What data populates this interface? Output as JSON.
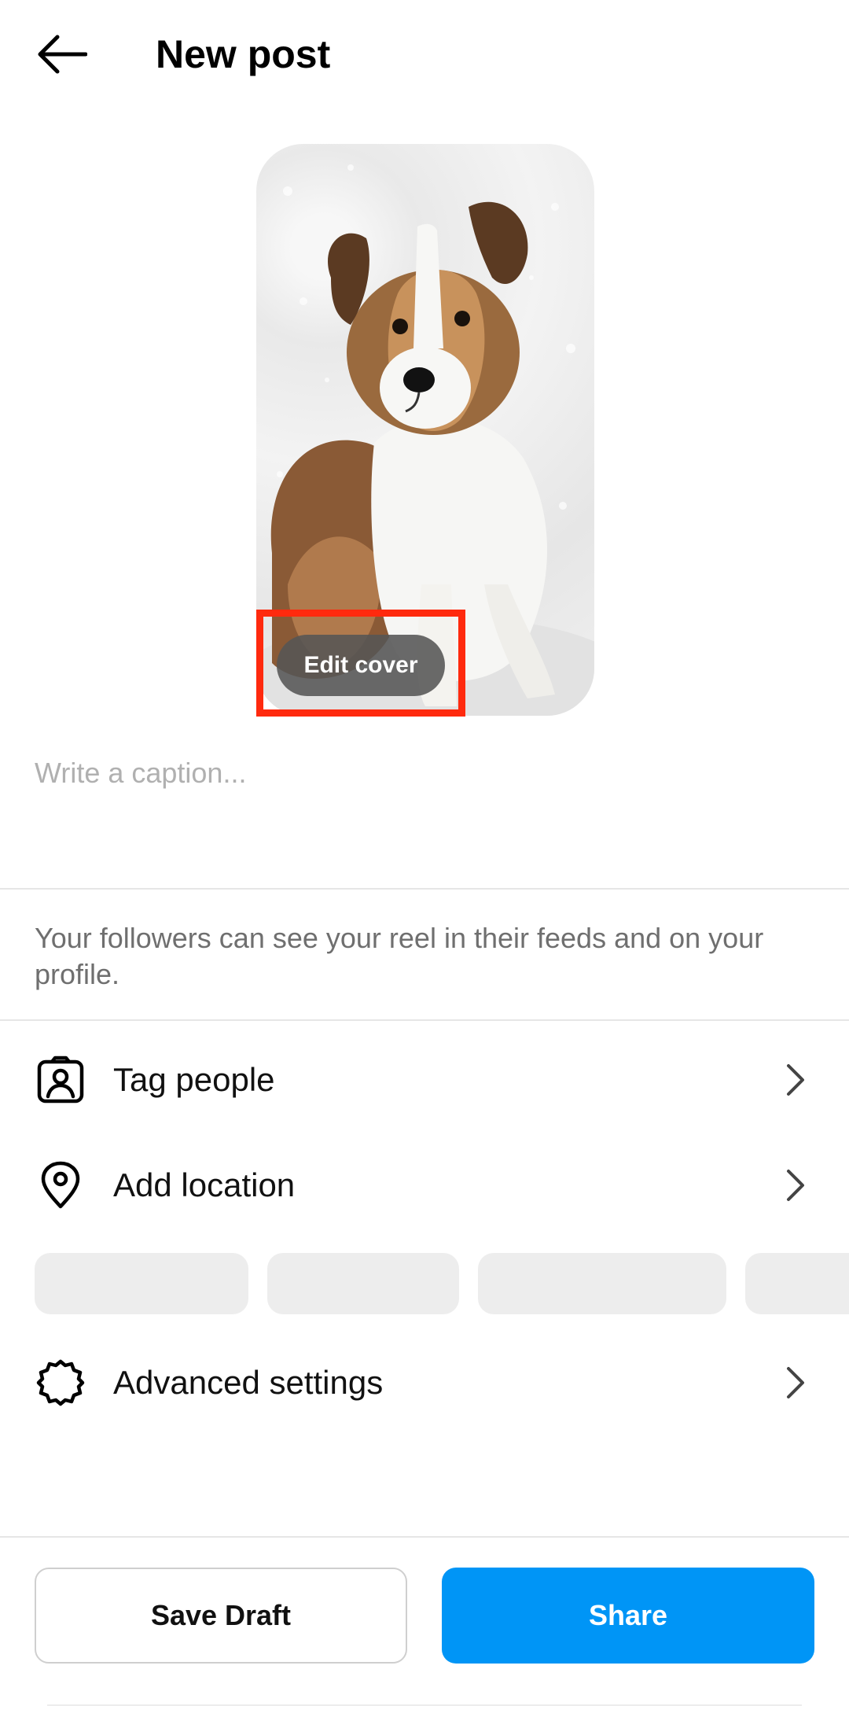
{
  "header": {
    "title": "New post",
    "back_icon": "arrow-left-icon"
  },
  "preview": {
    "edit_cover_label": "Edit cover",
    "image_subject": "puppy",
    "highlight_color": "#ff2a0e"
  },
  "caption": {
    "placeholder": "Write a caption..."
  },
  "visibility_note": "Your followers can see your reel in their feeds and on your profile.",
  "menu": {
    "tag_people": {
      "label": "Tag people",
      "icon": "tag-person-icon"
    },
    "add_location": {
      "label": "Add location",
      "icon": "location-pin-icon"
    },
    "advanced_settings": {
      "label": "Advanced settings",
      "icon": "settings-gear-icon"
    }
  },
  "actions": {
    "save_draft_label": "Save Draft",
    "share_label": "Share",
    "share_color": "#0095f6"
  }
}
